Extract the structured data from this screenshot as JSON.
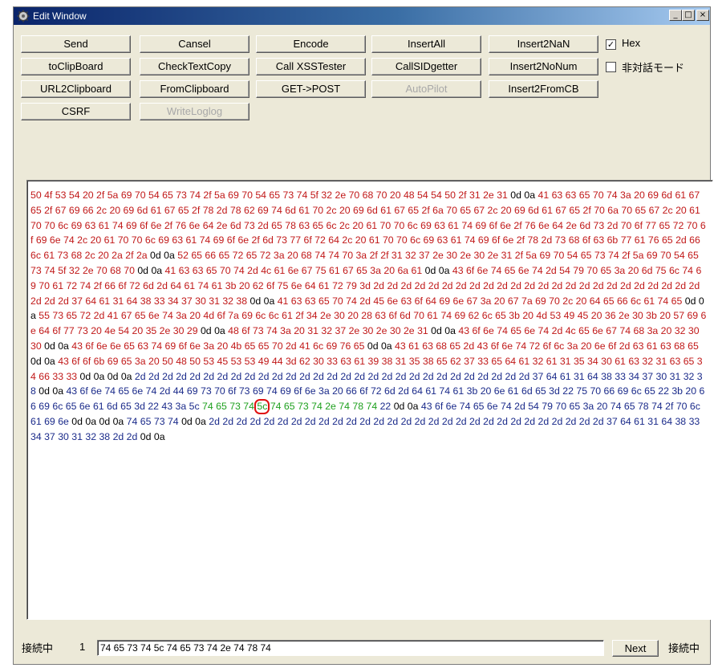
{
  "window": {
    "title": "Edit Window",
    "minimize": "_",
    "maximize": "□",
    "close": "×"
  },
  "buttons": {
    "send": "Send",
    "cansel": "Cansel",
    "encode": "Encode",
    "insert_all": "InsertAll",
    "insert2nan": "Insert2NaN",
    "to_clipboard": "toClipBoard",
    "check_text_copy": "CheckTextCopy",
    "call_xss_tester": "Call XSSTester",
    "call_sid_getter": "CallSIDgetter",
    "insert2nonum": "Insert2NoNum",
    "url2clipboard": "URL2Clipboard",
    "from_clipboard": "FromClipboard",
    "get_post": "GET->POST",
    "auto_pilot": "AutoPilot",
    "insert2fromcb": "Insert2FromCB",
    "csrf": "CSRF",
    "write_loglog": "WriteLoglog"
  },
  "checkboxes": {
    "hex": {
      "label": "Hex",
      "checked": true,
      "mark": "✓"
    },
    "non_interactive": {
      "label": "非対話モード",
      "checked": false,
      "mark": ""
    }
  },
  "hex_segments": [
    {
      "color": "red",
      "text": "50 4f 53 54 20 2f 5a 69 70 54 65 73 74 2f 5a 69 70 54 65 73 74 5f 32 2e 70 68 70 20 48 54 54 50 2f 31 2e 31 "
    },
    {
      "color": "black",
      "text": "0d 0a"
    },
    {
      "color": "red",
      "text": " 41 63 63 65 70 74 3a 20 69 6d 61 67 65 2f 67 69 66 2c 20 69 6d 61 67 65 2f 78 2d 78 62 69 74 6d 61 70 2c 20 69 6d 61 67 65 2f 6a 70 65 67 2c 20 69 6d 61 67 65 2f 70 6a 70 65 67 2c 20 61 70 70 6c 69 63 61 74 69 6f 6e 2f 76 6e 64 2e 6d 73 2d 65 78 63 65 6c 2c 20 61 70 70 6c 69 63 61 74 69 6f 6e 2f 76 6e 64 2e 6d 73 2d 70 6f 77 65 72 70 6f 69 6e 74 2c 20 61 70 70 6c 69 63 61 74 69 6f 6e 2f 6d 73 77 6f 72 64 2c 20 61 70 70 6c 69 63 61 74 69 6f 6e 2f 78 2d 73 68 6f 63 6b 77 61 76 65 2d 66 6c 61 73 68 2c 20 2a 2f 2a "
    },
    {
      "color": "black",
      "text": "0d 0a"
    },
    {
      "color": "red",
      "text": " 52 65 66 65 72 65 72 3a 20 68 74 74 70 3a 2f 2f 31 32 37 2e 30 2e 30 2e 31 2f 5a 69 70 54 65 73 74 2f 5a 69 70 54 65 73 74 5f 32 2e 70 68 70 "
    },
    {
      "color": "black",
      "text": "0d 0a"
    },
    {
      "color": "red",
      "text": " 41 63 63 65 70 74 2d 4c 61 6e 67 75 61 67 65 3a 20 6a 61 "
    },
    {
      "color": "black",
      "text": "0d 0a"
    },
    {
      "color": "red",
      "text": " 43 6f 6e 74 65 6e 74 2d 54 79 70 65 3a 20 6d 75 6c 74 69 70 61 72 74 2f 66 6f 72 6d 2d 64 61 74 61 3b 20 62 6f 75 6e 64 61 72 79 3d 2d 2d 2d 2d 2d 2d 2d 2d 2d 2d 2d 2d 2d 2d 2d 2d 2d 2d 2d 2d 2d 2d 2d 2d 2d 2d 2d 37 64 61 31 64 38 33 34 37 30 31 32 38 "
    },
    {
      "color": "black",
      "text": "0d 0a"
    },
    {
      "color": "red",
      "text": " 41 63 63 65 70 74 2d 45 6e 63 6f 64 69 6e 67 3a 20 67 7a 69 70 2c 20 64 65 66 6c 61 74 65 "
    },
    {
      "color": "black",
      "text": "0d 0a"
    },
    {
      "color": "red",
      "text": " 55 73 65 72 2d 41 67 65 6e 74 3a 20 4d 6f 7a 69 6c 6c 61 2f 34 2e 30 20 28 63 6f 6d 70 61 74 69 62 6c 65 3b 20 4d 53 49 45 20 36 2e 30 3b 20 57 69 6e 64 6f 77 73 20 4e 54 20 35 2e 30 29 "
    },
    {
      "color": "black",
      "text": "0d 0a"
    },
    {
      "color": "red",
      "text": " 48 6f 73 74 3a 20 31 32 37 2e 30 2e 30 2e 31 "
    },
    {
      "color": "black",
      "text": "0d 0a"
    },
    {
      "color": "red",
      "text": " 43 6f 6e 74 65 6e 74 2d 4c 65 6e 67 74 68 3a 20 32 30 30 "
    },
    {
      "color": "black",
      "text": "0d 0a"
    },
    {
      "color": "red",
      "text": " 43 6f 6e 6e 65 63 74 69 6f 6e 3a 20 4b 65 65 70 2d 41 6c 69 76 65 "
    },
    {
      "color": "black",
      "text": "0d 0a"
    },
    {
      "color": "red",
      "text": " 43 61 63 68 65 2d 43 6f 6e 74 72 6f 6c 3a 20 6e 6f 2d 63 61 63 68 65 "
    },
    {
      "color": "black",
      "text": "0d 0a"
    },
    {
      "color": "red",
      "text": " 43 6f 6f 6b 69 65 3a 20 50 48 50 53 45 53 53 49 44 3d 62 30 33 63 61 39 38 31 35 38 65 62 37 33 65 64 61 32 61 31 35 34 30 61 63 32 31 63 65 34 66 33 33 "
    },
    {
      "color": "black",
      "text": "0d 0a 0d 0a"
    },
    {
      "color": "blue",
      "text": " 2d 2d 2d 2d 2d 2d 2d 2d 2d 2d 2d 2d 2d 2d 2d 2d 2d 2d 2d 2d 2d 2d 2d 2d 2d 2d 2d 2d 2d 37 64 61 31 64 38 33 34 37 30 31 32 38 "
    },
    {
      "color": "black",
      "text": "0d 0a"
    },
    {
      "color": "blue",
      "text": " 43 6f 6e 74 65 6e 74 2d 44 69 73 70 6f 73 69 74 69 6f 6e 3a 20 66 6f 72 6d 2d 64 61 74 61 3b 20 6e 61 6d 65 3d 22 75 70 66 69 6c 65 22 3b 20 66 69 6c 65 6e 61 6d 65 3d 22 43 3a 5c "
    },
    {
      "color": "green",
      "text": "74 65 73 74 "
    },
    {
      "color": "green",
      "text": "5c",
      "highlight": true
    },
    {
      "color": "green",
      "text": " 74 65 73 74 2e 74 78 74"
    },
    {
      "color": "blue",
      "text": " 22 "
    },
    {
      "color": "black",
      "text": "0d 0a"
    },
    {
      "color": "blue",
      "text": " 43 6f 6e 74 65 6e 74 2d 54 79 70 65 3a 20 74 65 78 74 2f 70 6c 61 69 6e "
    },
    {
      "color": "black",
      "text": "0d 0a 0d 0a"
    },
    {
      "color": "blue",
      "text": " 74 65 73 74 "
    },
    {
      "color": "black",
      "text": "0d 0a"
    },
    {
      "color": "blue",
      "text": " 2d 2d 2d 2d 2d 2d 2d 2d 2d 2d 2d 2d 2d 2d 2d 2d 2d 2d 2d 2d 2d 2d 2d 2d 2d 2d 2d 2d 2d 37 64 61 31 64 38 33 34 37 30 31 32 38 2d 2d "
    },
    {
      "color": "black",
      "text": "0d 0a"
    }
  ],
  "status": {
    "connecting_label": "接続中",
    "count": "1",
    "hex_value": "74 65 73 74 5c 74 65 73 74 2e 74 78 74",
    "next_label": "Next",
    "connecting_label_right": "接続中"
  },
  "colors": {
    "red": "#c11818",
    "black": "#000000",
    "blue": "#1a2a8a",
    "green": "#1ea01e",
    "highlight": "#e01010",
    "title_start": "#0a246a",
    "title_end": "#a6caf0"
  },
  "icons": {
    "app": "settings-gear-icon"
  }
}
